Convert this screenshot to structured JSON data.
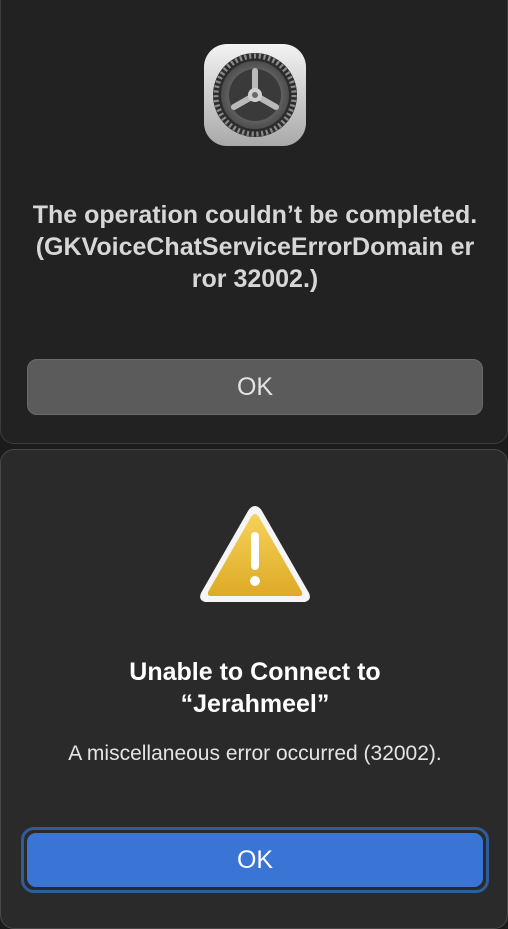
{
  "dialog_top": {
    "icon": "system-preferences-gear-icon",
    "title": "The operation couldn’t be completed. (GKVoiceChatServiceErrorDomain error 32002.)",
    "ok_label": "OK"
  },
  "dialog_bottom": {
    "icon": "warning-triangle-icon",
    "title_line1": "Unable to Connect to",
    "title_line2": "“Jerahmeel”",
    "message": "A miscellaneous error occurred (32002).",
    "ok_label": "OK"
  },
  "colors": {
    "background": "#1b1b1b",
    "dialog_top_bg": "#222222",
    "dialog_bottom_bg": "#2a2a2a",
    "secondary_button": "#5b5b5b",
    "accent_button": "#3a74d4",
    "warning_yellow": "#e8b830"
  }
}
